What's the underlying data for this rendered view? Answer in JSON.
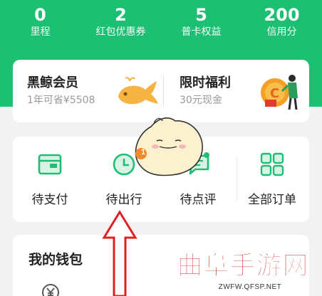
{
  "stats": [
    {
      "value": "0",
      "label": "里程"
    },
    {
      "value": "2",
      "label": "红包优惠券"
    },
    {
      "value": "5",
      "label": "普卡权益"
    },
    {
      "value": "200",
      "label": "信用分"
    }
  ],
  "membership": {
    "title": "黑鲸会员",
    "subtitle": "1年可省¥5508"
  },
  "welfare": {
    "title": "限时福利",
    "subtitle": "30元现金"
  },
  "orders": [
    {
      "label": "待支付",
      "icon": "wallet-icon"
    },
    {
      "label": "待出行",
      "icon": "clock-icon"
    },
    {
      "label": "待点评",
      "icon": "comment-icon"
    },
    {
      "label": "全部订单",
      "icon": "grid-icon"
    }
  ],
  "mascot_badge": "1",
  "wallet": {
    "title": "我的钱包"
  },
  "watermark": {
    "text": "曲阜手游网",
    "url": "ZWFW.QFSP.NET"
  },
  "colors": {
    "brand_green": "#1dbf73",
    "watermark_red": "#d01c16",
    "arrow_red": "#e02020"
  }
}
